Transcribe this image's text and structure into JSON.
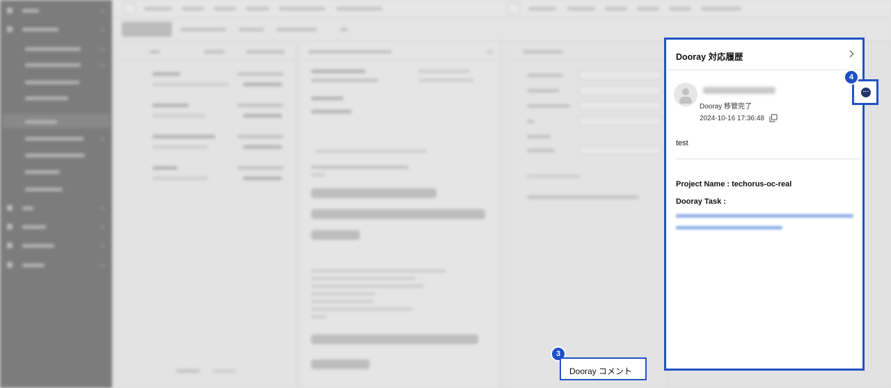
{
  "panel": {
    "title": "Dooray 対応履歴",
    "entry": {
      "status": "Dooray 移管完了",
      "timestamp": "2024-10-16 17:36:48",
      "message": "test",
      "project_label": "Project Name : techorus-oc-real",
      "task_label": "Dooray Task :"
    }
  },
  "callouts": {
    "step3": "3",
    "step4": "4",
    "tooltip": "Dooray コメント"
  },
  "icons": {
    "close": "chevron-right-icon",
    "copy": "copy-icon",
    "comment": "comment-icon",
    "avatar": "user-avatar-icon"
  },
  "colors": {
    "highlight": "#2152c6",
    "badge": "#1e4fc9"
  }
}
